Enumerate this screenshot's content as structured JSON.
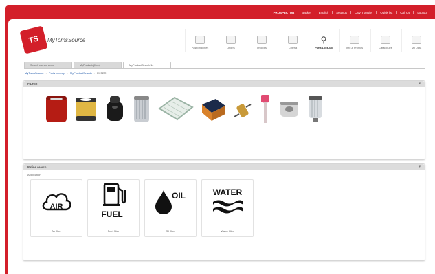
{
  "topbar": {
    "links": [
      "PROSPECTOR",
      "Basket",
      "English",
      "Settings",
      "CSV Transfer",
      "Quick list",
      "Call Us",
      "Log out"
    ]
  },
  "logo": {
    "mark": "TS",
    "name": "MyTomsSource"
  },
  "nav": {
    "items": [
      {
        "label": "Past Enquiries",
        "icon": "document-icon"
      },
      {
        "label": "Orders",
        "icon": "box-icon"
      },
      {
        "label": "Invoices",
        "icon": "invoice-icon"
      },
      {
        "label": "Criteria",
        "icon": "pencil-icon"
      },
      {
        "label": "Parts Look-up",
        "icon": "magnifier-icon"
      },
      {
        "label": "Info & Promos",
        "icon": "chart-icon"
      },
      {
        "label": "Catalogues",
        "icon": "catalogue-icon"
      },
      {
        "label": "My Data",
        "icon": "data-icon"
      }
    ]
  },
  "tabs": [
    "Search current area",
    "MyProducts(Item)",
    "MyProductSearch 1x"
  ],
  "breadcrumb": [
    "MyTomsSource",
    "Parts look-up",
    "MyProductSearch",
    "FILTER"
  ],
  "filter_panel": {
    "title": "FILTER"
  },
  "refine_panel": {
    "title": "Refine search",
    "application_label": "Application",
    "cards": [
      {
        "caption": "Air filter",
        "art_text": "AIR",
        "icon": "air-cloud-icon"
      },
      {
        "caption": "Fuel filter",
        "art_text": "FUEL",
        "icon": "fuel-pump-icon"
      },
      {
        "caption": "Oil filter",
        "art_text": "OIL",
        "icon": "oil-drop-icon"
      },
      {
        "caption": "Water filter",
        "art_text": "WATER",
        "icon": "water-waves-icon"
      }
    ]
  },
  "colors": {
    "brand": "#d31f2a",
    "panel_head": "#dcdcdc"
  }
}
